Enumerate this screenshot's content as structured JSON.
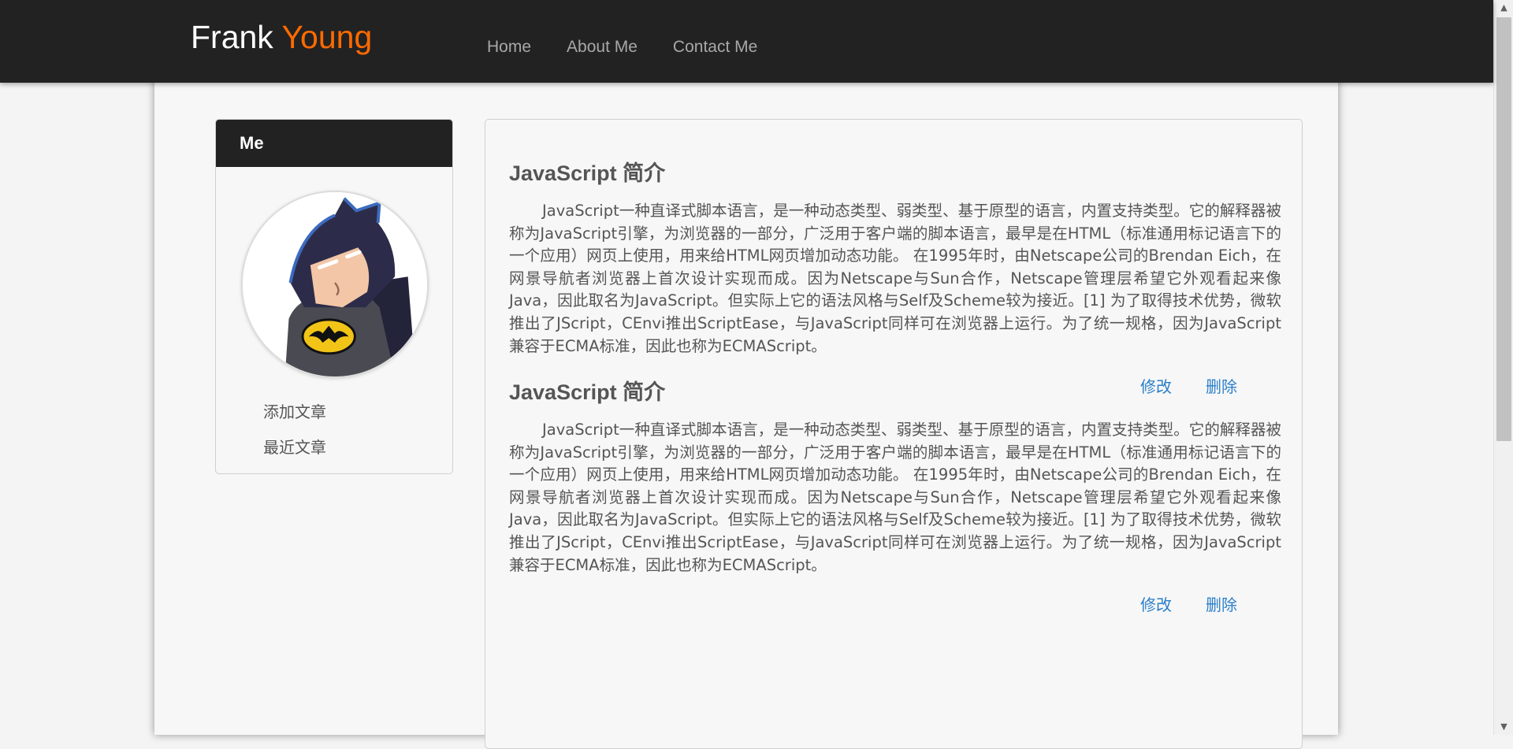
{
  "header": {
    "brand_first": "Frank",
    "brand_second": "Young",
    "nav": [
      "Home",
      "About Me",
      "Contact Me"
    ]
  },
  "sidebar": {
    "title": "Me",
    "links": [
      "添加文章",
      "最近文章"
    ]
  },
  "articles": [
    {
      "title": "JavaScript 简介",
      "body": "JavaScript一种直译式脚本语言，是一种动态类型、弱类型、基于原型的语言，内置支持类型。它的解释器被称为JavaScript引擎，为浏览器的一部分，广泛用于客户端的脚本语言，最早是在HTML（标准通用标记语言下的一个应用）网页上使用，用来给HTML网页增加动态功能。 在1995年时，由Netscape公司的Brendan Eich，在网景导航者浏览器上首次设计实现而成。因为Netscape与Sun合作，Netscape管理层希望它外观看起来像Java，因此取名为JavaScript。但实际上它的语法风格与Self及Scheme较为接近。[1] 为了取得技术优势，微软推出了JScript，CEnvi推出ScriptEase，与JavaScript同样可在浏览器上运行。为了统一规格，因为JavaScript兼容于ECMA标准，因此也称为ECMAScript。",
      "edit_label": "修改",
      "delete_label": "删除"
    },
    {
      "title": "JavaScript 简介",
      "body": "JavaScript一种直译式脚本语言，是一种动态类型、弱类型、基于原型的语言，内置支持类型。它的解释器被称为JavaScript引擎，为浏览器的一部分，广泛用于客户端的脚本语言，最早是在HTML（标准通用标记语言下的一个应用）网页上使用，用来给HTML网页增加动态功能。 在1995年时，由Netscape公司的Brendan Eich，在网景导航者浏览器上首次设计实现而成。因为Netscape与Sun合作，Netscape管理层希望它外观看起来像Java，因此取名为JavaScript。但实际上它的语法风格与Self及Scheme较为接近。[1] 为了取得技术优势，微软推出了JScript，CEnvi推出ScriptEase，与JavaScript同样可在浏览器上运行。为了统一规格，因为JavaScript兼容于ECMA标准，因此也称为ECMAScript。",
      "edit_label": "修改",
      "delete_label": "删除"
    }
  ],
  "colors": {
    "topbar": "#222222",
    "brand_accent": "#ff6a00",
    "link": "#2a7fc9",
    "page_bg": "#f4f4f4"
  },
  "icons": {
    "avatar": "batman-avatar-icon",
    "scroll_up": "scroll-up-arrow-icon",
    "scroll_down": "scroll-down-arrow-icon"
  }
}
